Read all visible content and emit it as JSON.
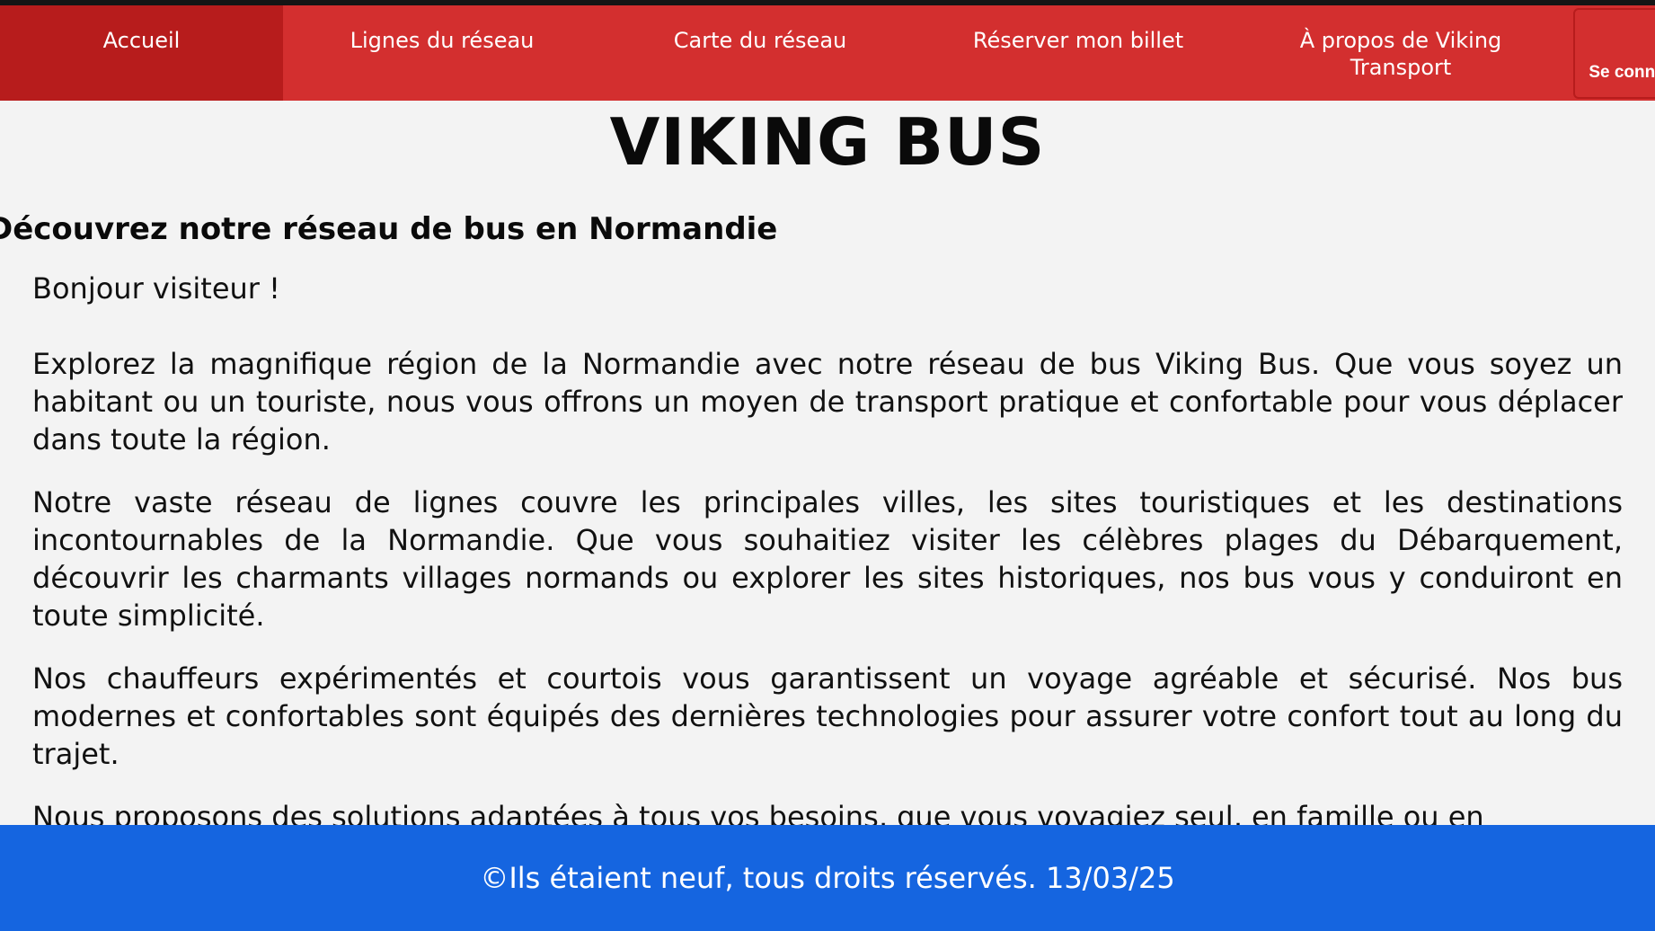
{
  "nav": {
    "items": [
      {
        "label": "Accueil"
      },
      {
        "label": "Lignes du réseau"
      },
      {
        "label": "Carte du réseau"
      },
      {
        "label": "Réserver mon billet"
      },
      {
        "label": "À propos de Viking Transport"
      }
    ],
    "login_label": "Se connecter"
  },
  "header": {
    "title": "VIKING BUS"
  },
  "main": {
    "heading": "Découvrez notre réseau de bus en Normandie",
    "greeting": "Bonjour visiteur !",
    "paragraphs": [
      "Explorez la magnifique région de la Normandie avec notre réseau de bus Viking Bus. Que vous soyez un habitant ou un touriste, nous vous offrons un moyen de transport pratique et confortable pour vous déplacer dans toute la région.",
      "Notre vaste réseau de lignes couvre les principales villes, les sites touristiques et les destinations incontournables de la Normandie. Que vous souhaitiez visiter les célèbres plages du Débarquement, découvrir les charmants villages normands ou explorer les sites historiques, nos bus vous y conduiront en toute simplicité.",
      "Nos chauffeurs expérimentés et courtois vous garantissent un voyage agréable et sécurisé. Nos bus modernes et confortables sont équipés des dernières technologies pour assurer votre confort tout au long du trajet.",
      "Nous proposons des solutions adaptées à tous vos besoins, que vous voyagiez seul, en famille ou en"
    ]
  },
  "footer": {
    "text": "©Ils étaient neuf, tous droits réservés. 13/03/25"
  },
  "colors": {
    "nav_background": "#d32f2f",
    "nav_active": "#b71c1c",
    "footer_background": "#1565e0",
    "page_background": "#f3f3f3"
  }
}
